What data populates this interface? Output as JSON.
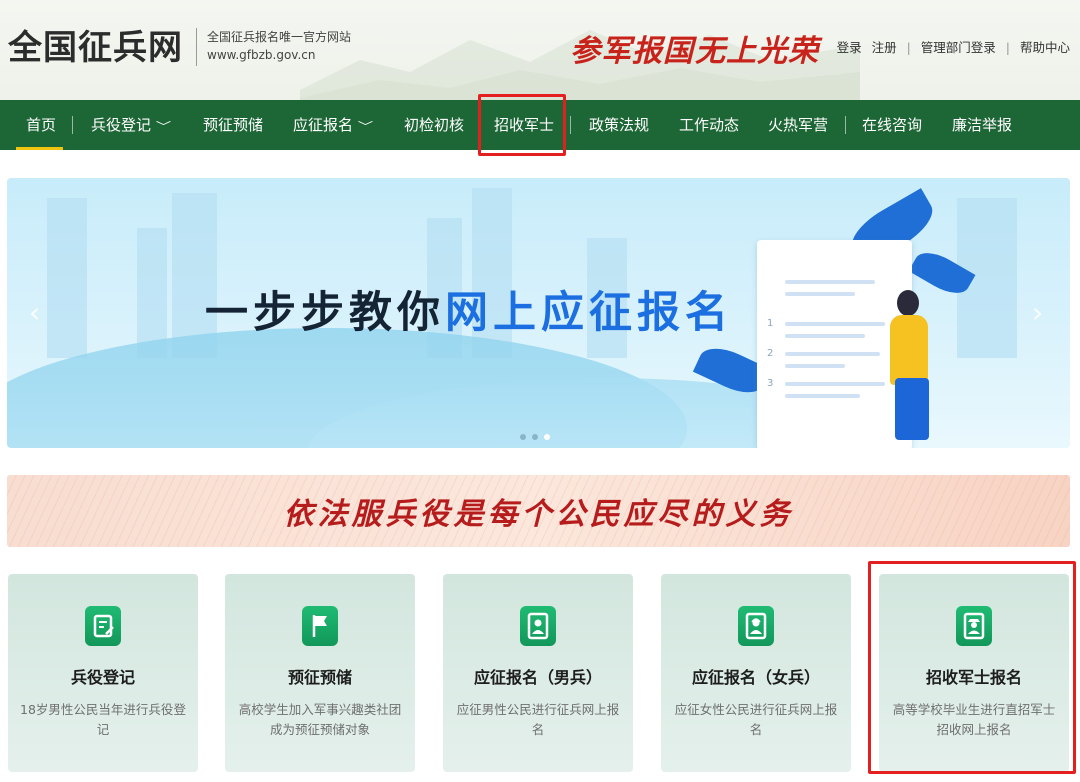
{
  "header": {
    "logo": "全国征兵网",
    "subtitle_line1": "全国征兵报名唯一官方网站",
    "subtitle_line2": "www.gfbzb.gov.cn",
    "slogan_left": "参军报国",
    "slogan_right": "无上光荣",
    "links": {
      "login": "登录",
      "register": "注册",
      "admin_login": "管理部门登录",
      "help": "帮助中心",
      "separator": "|"
    }
  },
  "nav": {
    "items": [
      {
        "label": "首页",
        "active": true
      },
      {
        "label": "兵役登记",
        "dropdown": true
      },
      {
        "label": "预征预储"
      },
      {
        "label": "应征报名",
        "dropdown": true
      },
      {
        "label": "初检初核"
      },
      {
        "label": "招收军士"
      },
      {
        "label": "政策法规"
      },
      {
        "label": "工作动态"
      },
      {
        "label": "火热军营"
      },
      {
        "label": "在线咨询"
      },
      {
        "label": "廉洁举报"
      }
    ],
    "chevron": "﹀"
  },
  "banner": {
    "title_plain": "一步步教你",
    "title_highlight": "网上应征报名",
    "prev_arrow": "‹",
    "next_arrow": "›",
    "steps": [
      "1",
      "2",
      "3"
    ],
    "slide_count": 3,
    "active_slide": 3
  },
  "slogan_banner": {
    "text": "依法服兵役是每个公民应尽的义务"
  },
  "cards": [
    {
      "title": "兵役登记",
      "desc": "18岁男性公民当年进行兵役登记",
      "icon": "edit-document-icon"
    },
    {
      "title": "预征预储",
      "desc": "高校学生加入军事兴趣类社团成为预征预储对象",
      "icon": "flag-icon"
    },
    {
      "title": "应征报名（男兵）",
      "desc": "应征男性公民进行征兵网上报名",
      "icon": "male-id-card-icon"
    },
    {
      "title": "应征报名（女兵）",
      "desc": "应征女性公民进行征兵网上报名",
      "icon": "female-id-card-icon"
    },
    {
      "title": "招收军士报名",
      "desc": "高等学校毕业生进行直招军士招收网上报名",
      "icon": "soldier-id-card-icon"
    }
  ],
  "colors": {
    "nav_bg": "#1d6636",
    "nav_active": "#f1c40f",
    "highlight_box": "#e3201f",
    "card_icon": "#12975a",
    "banner_highlight": "#1b6fe0"
  }
}
